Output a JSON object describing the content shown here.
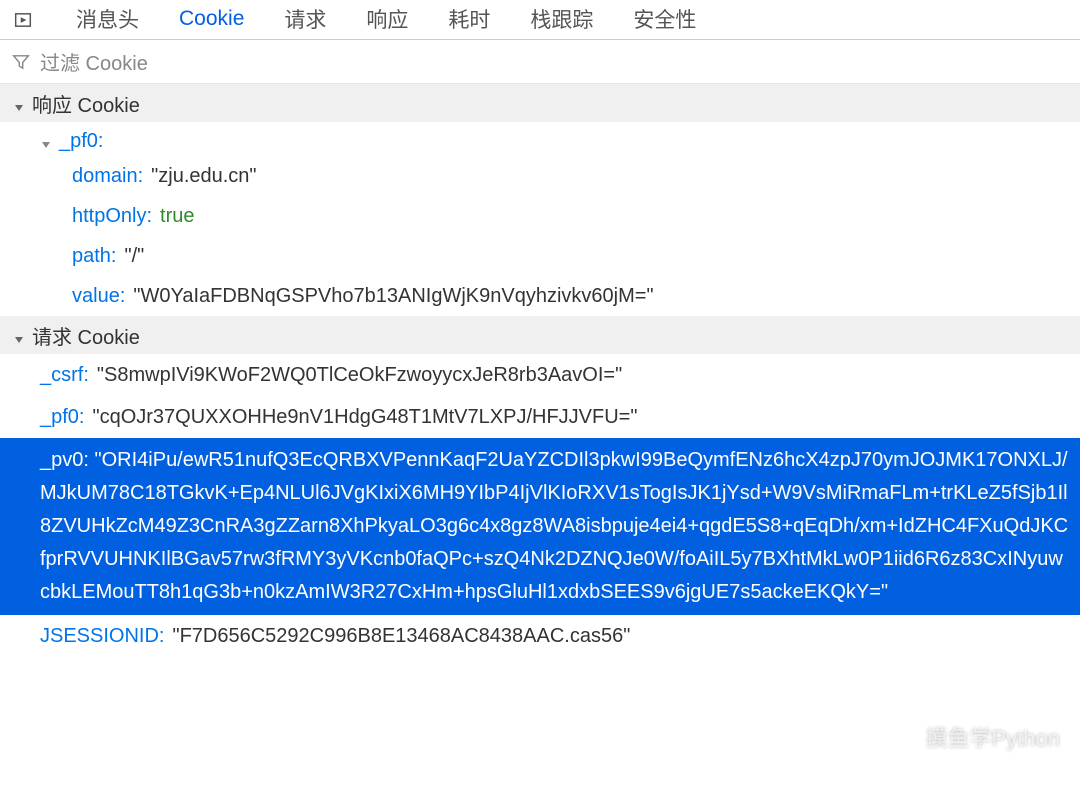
{
  "tabs": {
    "headers": "消息头",
    "cookie": "Cookie",
    "request": "请求",
    "response": "响应",
    "timing": "耗时",
    "stacktrace": "栈跟踪",
    "security": "安全性"
  },
  "filter": {
    "placeholder": "过滤 Cookie"
  },
  "response_section": {
    "title": "响应 Cookie",
    "cookies": [
      {
        "name": "_pf0:",
        "props": {
          "domain_key": "domain:",
          "domain_val": "\"zju.edu.cn\"",
          "httpOnly_key": "httpOnly:",
          "httpOnly_val": "true",
          "path_key": "path:",
          "path_val": "\"/\"",
          "value_key": "value:",
          "value_val": "\"W0YaIaFDBNqGSPVho7b13ANIgWjK9nVqyhzivkv60jM=\""
        }
      }
    ]
  },
  "request_section": {
    "title": "请求 Cookie",
    "cookies": {
      "csrf_key": "_csrf:",
      "csrf_val": "\"S8mwpIVi9KWoF2WQ0TlCeOkFzwoyycxJeR8rb3AavOI=\"",
      "pf0_key": "_pf0:",
      "pf0_val": "\"cqOJr37QUXXOHHe9nV1HdgG48T1MtV7LXPJ/HFJJVFU=\"",
      "pv0_key": "_pv0:",
      "pv0_val": "\"ORI4iPu/ewR51nufQ3EcQRBXVPennKaqF2UaYZCDIl3pkwI99BeQymfENz6hcX4zpJ70ymJOJMK17ONXLJ/MJkUM78C18TGkvK+Ep4NLUl6JVgKIxiX6MH9YIbP4IjVlKIoRXV1sTogIsJK1jYsd+W9VsMiRmaFLm+trKLeZ5fSjb1Il8ZVUHkZcM49Z3CnRA3gZZarn8XhPkyaLO3g6c4x8gz8WA8isbpuje4ei4+qgdE5S8+qEqDh/xm+IdZHC4FXuQdJKCfprRVVUHNKIlBGav57rw3fRMY3yVKcnb0faQPc+szQ4Nk2DZNQJe0W/foAiIL5y7BXhtMkLw0P1iid6R6z83CxINyuwcbkLEMouTT8h1qG3b+n0kzAmIW3R27CxHm+hpsGluHl1xdxbSEES9v6jgUE7s5ackeEKQkY=\"",
      "jsessionid_key": "JSESSIONID:",
      "jsessionid_val": "\"F7D656C5292C996B8E13468AC8438AAC.cas56\""
    }
  },
  "watermark": {
    "text": "摸鱼学Python"
  }
}
